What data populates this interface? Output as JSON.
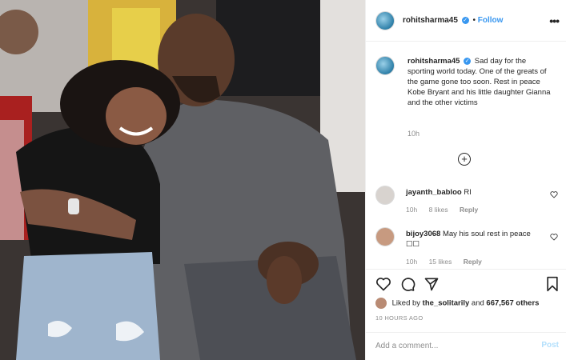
{
  "post": {
    "author": "rohitsharma45",
    "follow_label": "Follow",
    "more_label": "•••"
  },
  "caption": {
    "username": "rohitsharma45",
    "text": "Sad day for the sporting world today. One of the greats of the game gone too soon. Rest in peace Kobe Bryant and his little daughter Gianna and the other victims",
    "time": "10h",
    "load_more_icon": "plus-circle-icon"
  },
  "comments": [
    {
      "username": "jayanth_babloo",
      "text": "RI",
      "time": "10h",
      "likes": "8 likes",
      "reply": "Reply"
    },
    {
      "username": "bijoy3068",
      "text": "May his soul rest in peace ☐☐",
      "time": "10h",
      "likes": "15 likes",
      "reply": "Reply"
    }
  ],
  "actions": {
    "icons": [
      "heart-icon",
      "comment-icon",
      "share-icon",
      "bookmark-icon"
    ],
    "liked_by_prefix": "Liked by",
    "liked_by_user": "the_solitarily",
    "liked_by_and": "and",
    "others_count": "667,567 others",
    "timestamp": "10 HOURS AGO"
  },
  "add_comment": {
    "placeholder": "Add a comment...",
    "post_label": "Post"
  },
  "colors": {
    "accent": "#3897f0",
    "post_disabled": "#b2dffc",
    "muted": "#8e8e8e",
    "divider": "#efefef"
  }
}
